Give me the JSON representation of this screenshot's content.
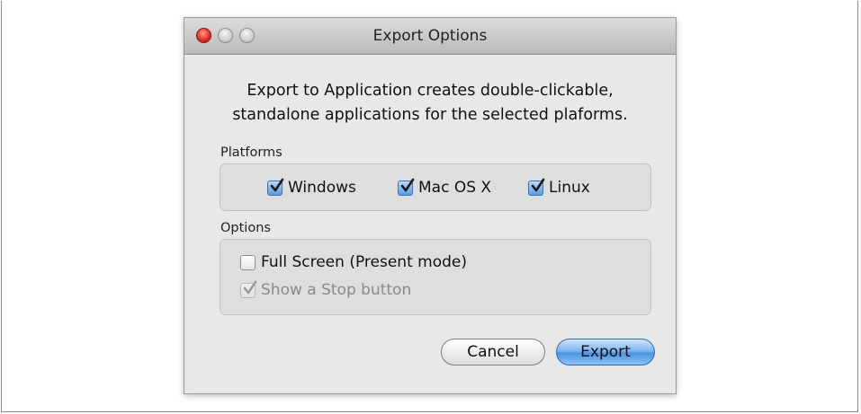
{
  "window": {
    "title": "Export Options"
  },
  "description": {
    "line1": "Export to Application creates double-clickable,",
    "line2": "standalone applications for the selected plaforms."
  },
  "platforms": {
    "label": "Platforms",
    "items": [
      {
        "label": "Windows",
        "checked": true
      },
      {
        "label": "Mac OS X",
        "checked": true
      },
      {
        "label": "Linux",
        "checked": true
      }
    ]
  },
  "options": {
    "label": "Options",
    "full_screen": {
      "label": "Full Screen (Present mode)",
      "checked": false
    },
    "stop_button": {
      "label": "Show a Stop button",
      "checked": true,
      "disabled": true
    }
  },
  "buttons": {
    "cancel": "Cancel",
    "export": "Export"
  },
  "colors": {
    "accent": "#5a9be0",
    "close_light": "#e0302a"
  }
}
